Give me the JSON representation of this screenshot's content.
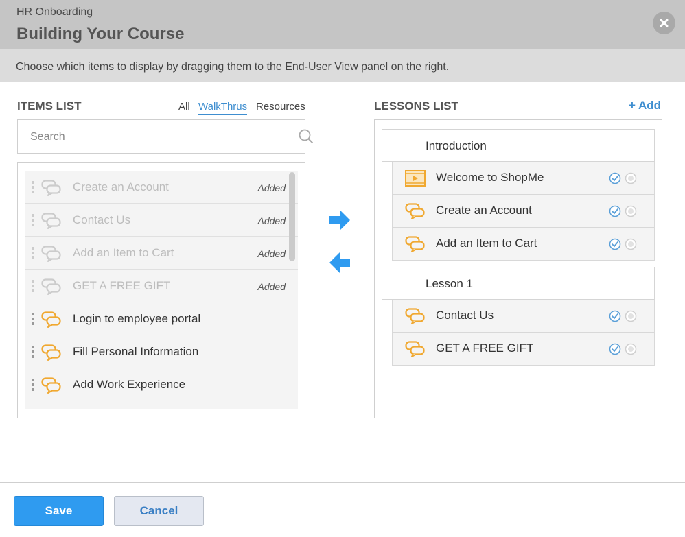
{
  "header": {
    "app_name": "HR Onboarding",
    "title": "Building Your Course",
    "close_icon": "close-icon"
  },
  "instruction": "Choose which items to display by dragging them to the End-User View panel on the right.",
  "items_panel": {
    "title": "ITEMS LIST",
    "filters": [
      "All",
      "WalkThrus",
      "Resources"
    ],
    "active_filter": "WalkThrus",
    "search_placeholder": "Search",
    "items": [
      {
        "label": "Create an Account",
        "status": "Added",
        "added": true
      },
      {
        "label": "Contact Us",
        "status": "Added",
        "added": true
      },
      {
        "label": "Add an Item to Cart",
        "status": "Added",
        "added": true
      },
      {
        "label": "GET A FREE GIFT",
        "status": "Added",
        "added": true
      },
      {
        "label": "Login to employee portal",
        "status": "",
        "added": false
      },
      {
        "label": "Fill Personal Information",
        "status": "",
        "added": false
      },
      {
        "label": "Add Work Experience",
        "status": "",
        "added": false
      },
      {
        "label": "",
        "status": "",
        "added": false
      }
    ]
  },
  "lessons_panel": {
    "title": "LESSONS LIST",
    "add_label": "+ Add",
    "lessons": [
      {
        "name": "Introduction",
        "items": [
          {
            "label": "Welcome to ShopMe",
            "icon": "video-icon"
          },
          {
            "label": "Create an Account",
            "icon": "walkthru-icon"
          },
          {
            "label": "Add an Item to Cart",
            "icon": "walkthru-icon"
          }
        ]
      },
      {
        "name": "Lesson 1",
        "items": [
          {
            "label": "Contact Us",
            "icon": "walkthru-icon"
          },
          {
            "label": "GET A FREE GIFT",
            "icon": "walkthru-icon"
          }
        ]
      }
    ]
  },
  "footer": {
    "save_label": "Save",
    "cancel_label": "Cancel"
  },
  "colors": {
    "accent": "#3e8ed0",
    "save_button": "#2f9bf0",
    "arrow": "#2f9bf0",
    "walkthru_icon": "#f0a830",
    "header_bg": "#c5c5c5"
  }
}
